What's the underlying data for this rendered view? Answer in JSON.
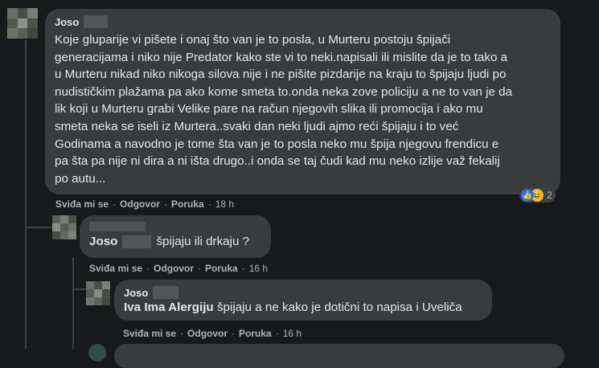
{
  "comments": [
    {
      "author": "Joso",
      "text": "Koje gluparije vi pišete i onaj što van je to posla, u Murteru postoju špijači\ngeneracijama i niko nije Predator kako ste vi to neki.napisali ili mislite da je to tako a\nu Murteru nikad niko nikoga silova nije i ne pišite pizdarije na kraju to špijaju ljudi po\nnudističkim plažama pa ako kome smeta to.onda neka zove policiju a ne to van je da\nlik koji u Murteru grabi Velike pare na račun njegovih slika ili promocija i ako mu\nsmeta neka se iseli iz Murtera..svaki dan neki ljudi ajmo reći špijaju i to već\nGodinama a navodno je tome šta van je to posla neko mu špija njegovu frendicu e\npa šta pa nije ni dira a ni išta drugo..i onda se taj čudi kad mu neko izlije važ fekalij\npo autu...",
      "like_label": "Sviđa mi se",
      "reply_label": "Odgovor",
      "message_label": "Poruka",
      "time": "18 h",
      "reaction_count": "2"
    },
    {
      "author": "Joso",
      "text": "špijaju ili drkaju ?",
      "like_label": "Sviđa mi se",
      "reply_label": "Odgovor",
      "message_label": "Poruka",
      "time": "16 h"
    },
    {
      "author": "Joso",
      "mention": "Iva Ima Alergiju",
      "text": "špijaju a ne kako je dotični to napisa i Uveliča",
      "like_label": "Sviđa mi se",
      "reply_label": "Odgovor",
      "message_label": "Poruka",
      "time": "16 h"
    }
  ],
  "separator": "·",
  "colors": {
    "background": "#18191a",
    "bubble": "#3a3b3c",
    "text": "#e4e6eb",
    "muted": "#b0b3b8",
    "like_blue": "#1877f2",
    "haha_yellow": "#f7b928"
  },
  "icons": [
    "like-icon",
    "haha-icon"
  ]
}
